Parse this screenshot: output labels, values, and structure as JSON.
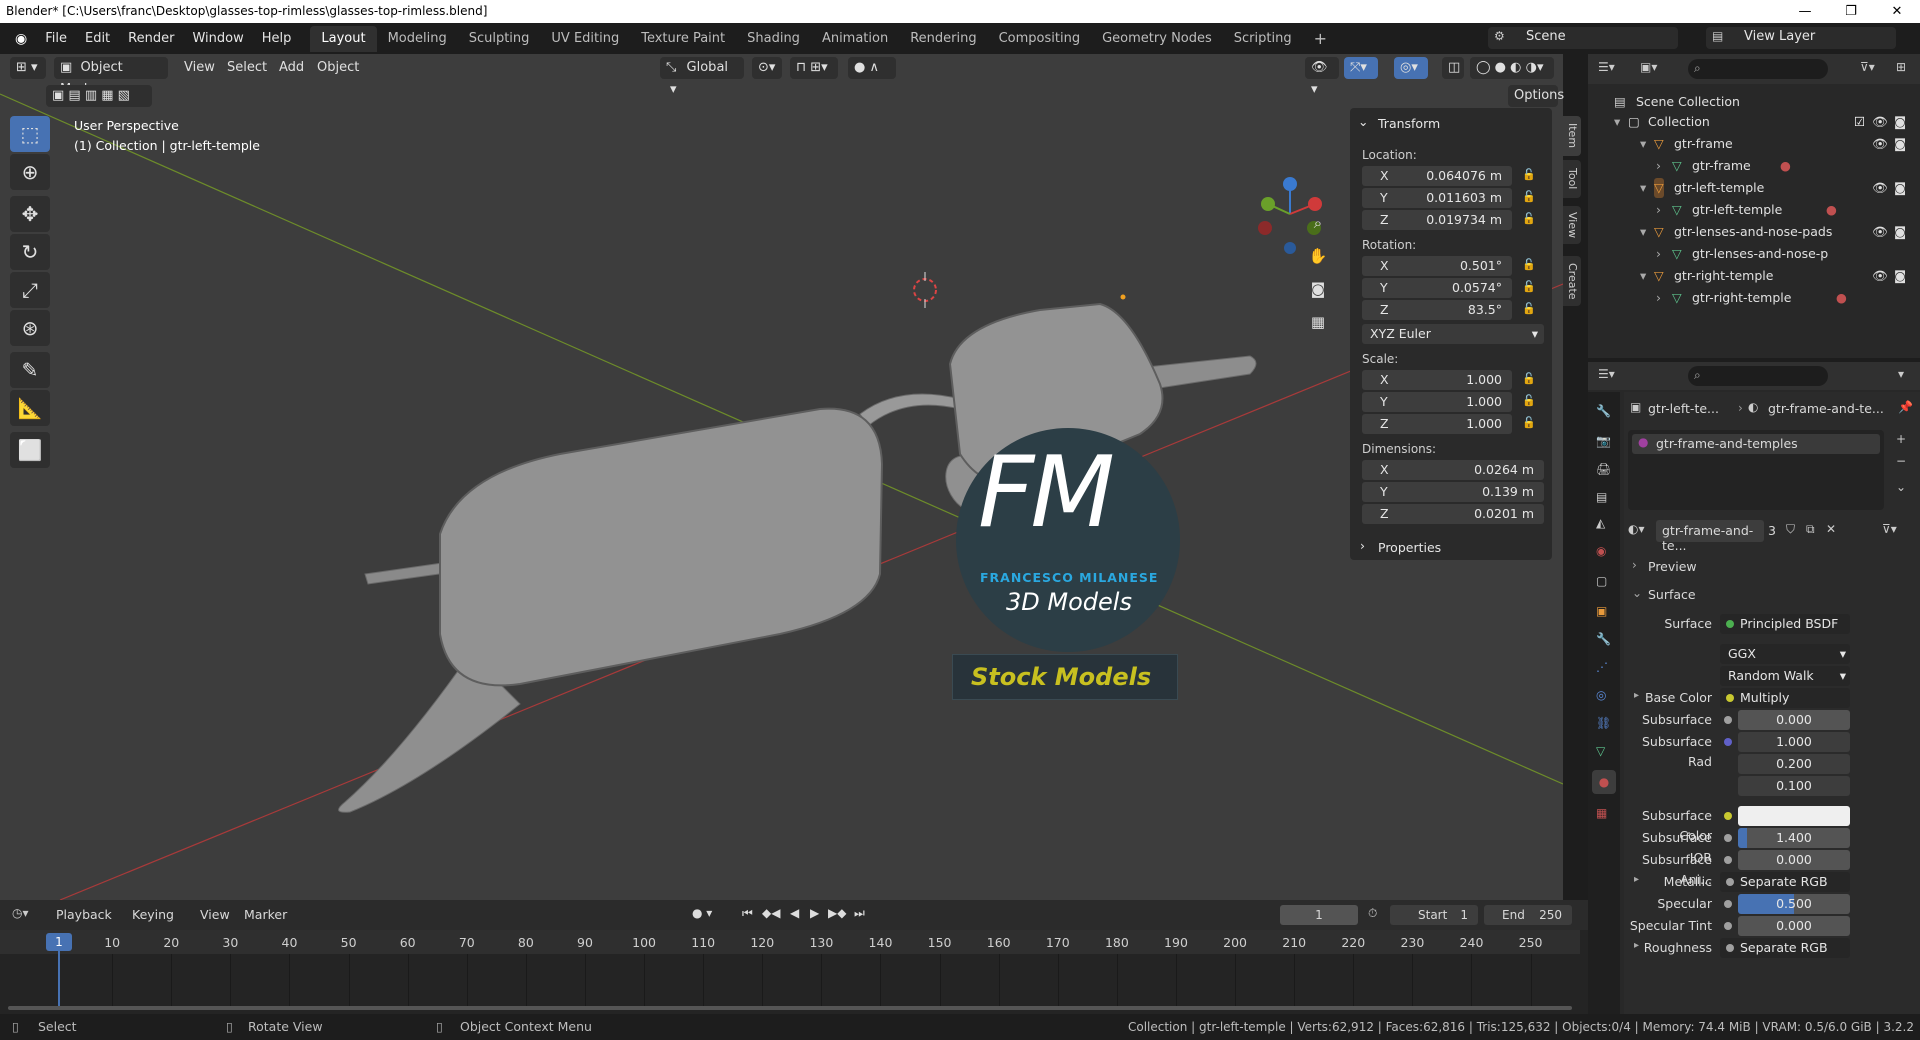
{
  "window": {
    "title": "Blender* [C:\\Users\\franc\\Desktop\\glasses-top-rimless\\glasses-top-rimless.blend]",
    "minimize": "—",
    "maximize": "❐",
    "close": "✕"
  },
  "menu": [
    "File",
    "Edit",
    "Render",
    "Window",
    "Help"
  ],
  "workspace_tabs": [
    "Layout",
    "Modeling",
    "Sculpting",
    "UV Editing",
    "Texture Paint",
    "Shading",
    "Animation",
    "Rendering",
    "Compositing",
    "Geometry Nodes",
    "Scripting"
  ],
  "active_tab": "Layout",
  "scene": {
    "scene_name": "Scene",
    "view_layer": "View Layer"
  },
  "viewport_header": {
    "mode": "Object Mode",
    "view": "View",
    "select": "Select",
    "add": "Add",
    "object": "Object",
    "transform_orientation": "Global",
    "options": "Options"
  },
  "viewport_info": {
    "line1": "User Perspective",
    "line2": "(1) Collection | gtr-left-temple"
  },
  "watermark": {
    "logo": "FM",
    "brand": "FRANCESCO MILANESE",
    "sub": "3D Models",
    "tag": "Stock Models"
  },
  "transform_panel": {
    "title": "Transform",
    "location_label": "Location:",
    "location": [
      {
        "axis": "X",
        "value": "0.064076 m"
      },
      {
        "axis": "Y",
        "value": "0.011603 m"
      },
      {
        "axis": "Z",
        "value": "0.019734 m"
      }
    ],
    "rotation_label": "Rotation:",
    "rotation": [
      {
        "axis": "X",
        "value": "0.501°"
      },
      {
        "axis": "Y",
        "value": "0.0574°"
      },
      {
        "axis": "Z",
        "value": "83.5°"
      }
    ],
    "rotation_mode": "XYZ Euler",
    "scale_label": "Scale:",
    "scale": [
      {
        "axis": "X",
        "value": "1.000"
      },
      {
        "axis": "Y",
        "value": "1.000"
      },
      {
        "axis": "Z",
        "value": "1.000"
      }
    ],
    "dimensions_label": "Dimensions:",
    "dimensions": [
      {
        "axis": "X",
        "value": "0.0264 m"
      },
      {
        "axis": "Y",
        "value": "0.139 m"
      },
      {
        "axis": "Z",
        "value": "0.0201 m"
      }
    ],
    "properties": "Properties"
  },
  "side_tabs": [
    "Item",
    "Tool",
    "View",
    "Create"
  ],
  "outliner": {
    "scene_collection": "Scene Collection",
    "collection": "Collection",
    "items": [
      "gtr-frame",
      "gtr-frame",
      "gtr-left-temple",
      "gtr-left-temple",
      "gtr-lenses-and-nose-pads",
      "gtr-lenses-and-nose-p",
      "gtr-right-temple",
      "gtr-right-temple"
    ]
  },
  "properties": {
    "breadcrumb_object": "gtr-left-te...",
    "breadcrumb_material": "gtr-frame-and-te...",
    "material_slot": "gtr-frame-and-temples",
    "material_name": "gtr-frame-and-te...",
    "user_count": "3",
    "preview": "Preview",
    "surface_section": "Surface",
    "surface_label": "Surface",
    "surface_value": "Principled BSDF",
    "distribution": "GGX",
    "subsurface_method": "Random Walk",
    "rows": [
      {
        "label": "Base Color",
        "value": "Multiply"
      },
      {
        "label": "Subsurface",
        "value": "0.000"
      },
      {
        "label": "Subsurface Rad",
        "value": "1.000"
      },
      {
        "label": "",
        "value": "0.200"
      },
      {
        "label": "",
        "value": "0.100"
      },
      {
        "label": "Subsurface Color",
        "value": ""
      },
      {
        "label": "Subsurface IOR",
        "value": "1.400"
      },
      {
        "label": "Subsurface Ani...",
        "value": "0.000"
      },
      {
        "label": "Metallic",
        "value": "Separate RGB"
      },
      {
        "label": "Specular",
        "value": "0.500"
      },
      {
        "label": "Specular Tint",
        "value": "0.000"
      },
      {
        "label": "Roughness",
        "value": "Separate RGB"
      }
    ]
  },
  "timeline": {
    "playback": "Playback",
    "keying": "Keying",
    "view": "View",
    "marker": "Marker",
    "current_frame": "1",
    "start_label": "Start",
    "start": "1",
    "end_label": "End",
    "end": "250",
    "ticks": [
      "1",
      "10",
      "20",
      "30",
      "40",
      "50",
      "60",
      "70",
      "80",
      "90",
      "100",
      "110",
      "120",
      "130",
      "140",
      "150",
      "160",
      "170",
      "180",
      "190",
      "200",
      "210",
      "220",
      "230",
      "240",
      "250"
    ]
  },
  "statusbar": {
    "select": "Select",
    "rotate": "Rotate View",
    "context": "Object Context Menu",
    "stats": "Collection | gtr-left-temple | Verts:62,912 | Faces:62,816 | Tris:125,632 | Objects:0/4 | Memory: 74.4 MiB | VRAM: 0.5/6.0 GiB | 3.2.2"
  },
  "colors": {
    "accent": "#4772b3",
    "viewport_bg": "#3d3d3d",
    "x_axis": "#a83a3a",
    "y_axis": "#6d8c2a",
    "logo_blue": "#2aa8e0",
    "stock_yellow": "#c8c020"
  }
}
